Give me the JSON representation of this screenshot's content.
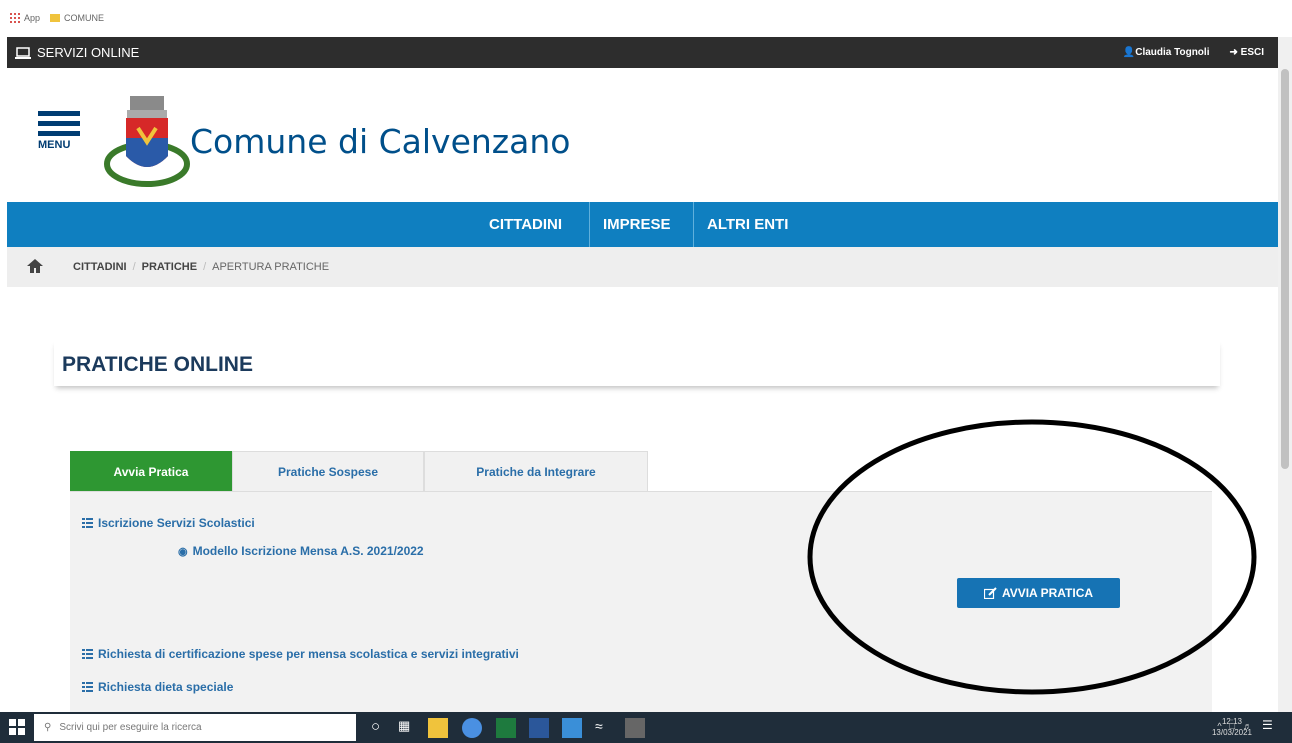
{
  "bookmarks": {
    "apps": "App",
    "folder": "COMUNE"
  },
  "topbar": {
    "title": "SERVIZI ONLINE",
    "user": "Claudia Tognoli",
    "logout": "ESCI"
  },
  "header": {
    "menu_label": "MENU",
    "site_title": "Comune di Calvenzano"
  },
  "nav": {
    "items": [
      "CITTADINI",
      "IMPRESE",
      "ALTRI ENTI"
    ]
  },
  "breadcrumb": {
    "items": [
      "CITTADINI",
      "PRATICHE",
      "APERTURA PRATICHE"
    ]
  },
  "page": {
    "title": "PRATICHE ONLINE"
  },
  "tabs": [
    "Avvia Pratica",
    "Pratiche Sospese",
    "Pratiche da Integrare"
  ],
  "entries": {
    "iscrizione": "Iscrizione Servizi Scolastici",
    "modello": "Modello Iscrizione Mensa A.S. 2021/2022",
    "certificazione": "Richiesta di certificazione spese per mensa scolastica e servizi integrativi",
    "dieta": "Richiesta dieta speciale"
  },
  "action": {
    "avvia_label": "AVVIA PRATICA"
  },
  "taskbar": {
    "search_placeholder": "Scrivi qui per eseguire la ricerca",
    "time": "12:13",
    "date": "13/03/2021"
  },
  "colors": {
    "navbar": "#0f7fc0",
    "active_tab": "#2e9732",
    "button": "#1673b4",
    "topbar": "#2d2d2d"
  }
}
